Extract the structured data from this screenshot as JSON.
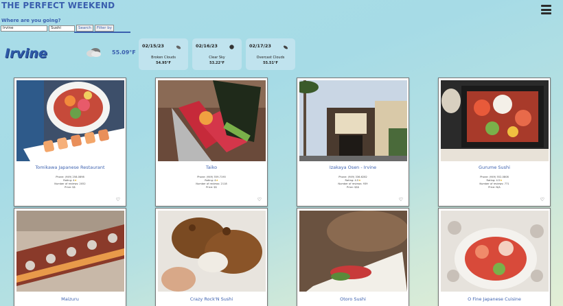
{
  "header": {
    "title": "THE PERFECT WEEKEND",
    "menu_icon": "hamburger-menu-icon"
  },
  "search": {
    "prompt": "Where are you going?",
    "location_value": "Irvine",
    "term_value": "Sushi",
    "search_label": "Search",
    "filter_label": "Filter by"
  },
  "weather": {
    "city": "Irvine",
    "current_temp": "55.09°F",
    "current_icon": "cloudy-icon",
    "forecast": [
      {
        "date": "02/15/23",
        "desc": "Broken Clouds",
        "temp": "54.95°F",
        "icon": "broken-clouds-icon"
      },
      {
        "date": "02/16/23",
        "desc": "Clear Sky",
        "temp": "53.22°F",
        "icon": "clear-sky-icon"
      },
      {
        "date": "02/17/23",
        "desc": "Overcast Clouds",
        "temp": "55.51°F",
        "icon": "overcast-clouds-icon"
      }
    ]
  },
  "restaurants": [
    {
      "name": "Tomikawa Japanese Restaurant",
      "phone": "Phone: (949) 258-0898",
      "rating_label": "Rating: 4",
      "stars": "★",
      "reviews": "Number of reviews: 2052",
      "price": "Price: $$"
    },
    {
      "name": "Taiko",
      "phone": "Phone: (949) 559-7190",
      "rating_label": "Rating: 4",
      "stars": "★",
      "reviews": "Number of reviews: 2118",
      "price": "Price: $$"
    },
    {
      "name": "Izakaya Osen - Irvine",
      "phone": "Phone: (949) 336-6282",
      "rating_label": "Rating: 4.5",
      "stars": "★",
      "reviews": "Number of reviews: 939",
      "price": "Price: $$$"
    },
    {
      "name": "Gurume Sushi",
      "phone": "Phone: (949) 552-0808",
      "rating_label": "Rating: 4.5",
      "stars": "★",
      "reviews": "Number of reviews: 771",
      "price": "Price: N/A"
    },
    {
      "name": "Maizuru"
    },
    {
      "name": "Crazy Rock'N Sushi"
    },
    {
      "name": "Otoro Sushi"
    },
    {
      "name": "O Fine Japanese Cuisine"
    }
  ],
  "heart_icon": "♡",
  "colors": {
    "accent": "#3a5fae",
    "background_start": "#a9dde8",
    "background_end": "#e3efd5"
  }
}
